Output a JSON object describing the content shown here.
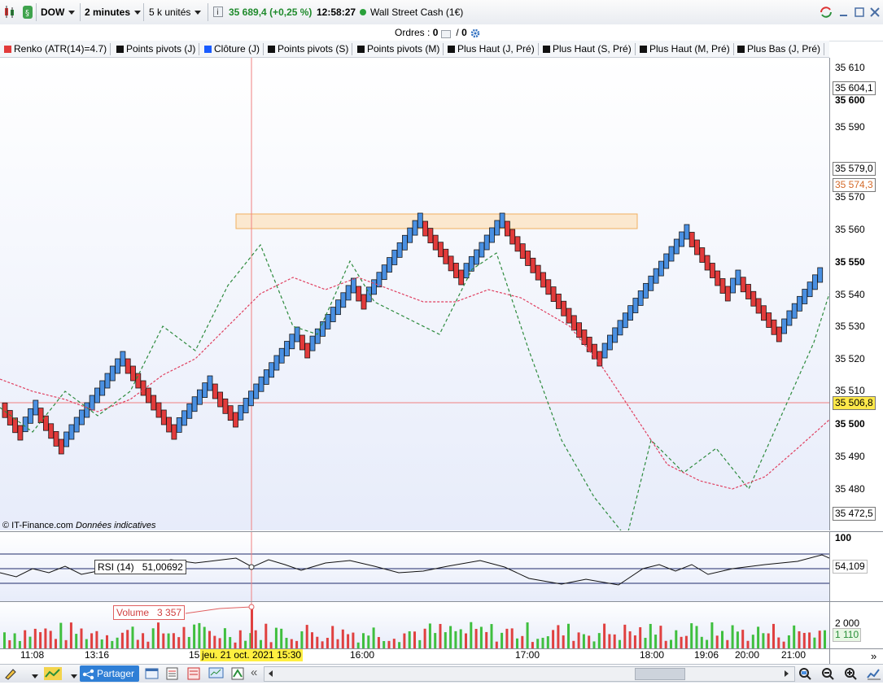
{
  "toolbar": {
    "symbol": "DOW",
    "timeframe": "2 minutes",
    "renko_unit": "5 k unités",
    "price": "35 689,4",
    "change": "(+0,25 %)",
    "time": "12:58:27",
    "instrument": "Wall Street Cash (1€)"
  },
  "orders": {
    "label": "Ordres :",
    "count1": "0",
    "sep": "/",
    "count2": "0"
  },
  "legend": [
    {
      "label": "Renko (ATR(14)=4.7)",
      "color": "#e23b3b"
    },
    {
      "label": "Points pivots (J)",
      "color": "#111111"
    },
    {
      "label": "Clôture (J)",
      "color": "#1a5cff"
    },
    {
      "label": "Points pivots (S)",
      "color": "#111111"
    },
    {
      "label": "Points pivots (M)",
      "color": "#111111"
    },
    {
      "label": "Plus Haut (J, Pré)",
      "color": "#111111"
    },
    {
      "label": "Plus Haut (S, Pré)",
      "color": "#111111"
    },
    {
      "label": "Plus Haut (M, Pré)",
      "color": "#111111"
    },
    {
      "label": "Plus Bas (J, Pré)",
      "color": "#111111"
    }
  ],
  "price_axis": {
    "ticks": [
      "35 610",
      "35 600",
      "35 590",
      "35 570",
      "35 560",
      "35 550",
      "35 540",
      "35 530",
      "35 520",
      "35 510",
      "35 500",
      "35 490",
      "35 480"
    ],
    "boxes": [
      "35 604,1",
      "35 579,0",
      "35 574,3",
      "35 506,8",
      "35 472,5"
    ]
  },
  "watermark": {
    "source": "© IT-Finance.com",
    "note": "Données indicatives"
  },
  "rsi": {
    "label": "RSI (14)",
    "value": "51,00692",
    "axis_top": "100",
    "axis_value": "54,109"
  },
  "volume": {
    "label": "Volume",
    "value": "3 357",
    "axis_tick": "2 000",
    "axis_value": "1 110"
  },
  "time_axis": {
    "labels": [
      "11:08",
      "13:16",
      "15",
      "16:00",
      "17:00",
      "18:00",
      "19:06",
      "20:00",
      "21:00"
    ],
    "cursor": "jeu. 21 oct. 2021 15:30"
  },
  "bottombar": {
    "share": "Partager"
  },
  "colors": {
    "up": "#4a90e2",
    "down": "#e23b3b",
    "fast_ma": "#2e8b3e",
    "slow_ma": "#e04060",
    "zone": "#fbe8cf"
  }
}
